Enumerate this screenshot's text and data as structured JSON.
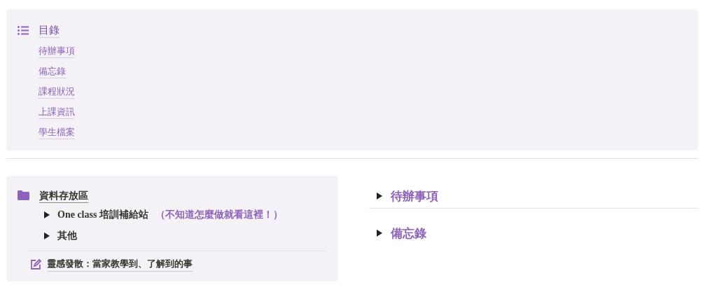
{
  "toc": {
    "title": "目錄",
    "items": [
      "待辦事項",
      "備忘錄",
      "課程狀況",
      "上課資訊",
      "學生檔案"
    ]
  },
  "storage": {
    "title": "資料存放區",
    "toggles": [
      {
        "label": "One class 培訓補給站",
        "note": "（不知道怎麼做就看這裡！）",
        "expanded": false
      },
      {
        "label": "其他",
        "expanded": false
      }
    ],
    "link": "靈感發散：當家教學到、了解到的事"
  },
  "sections": [
    {
      "title": "待辦事項",
      "expanded": false
    },
    {
      "title": "備忘錄",
      "expanded": false
    }
  ]
}
